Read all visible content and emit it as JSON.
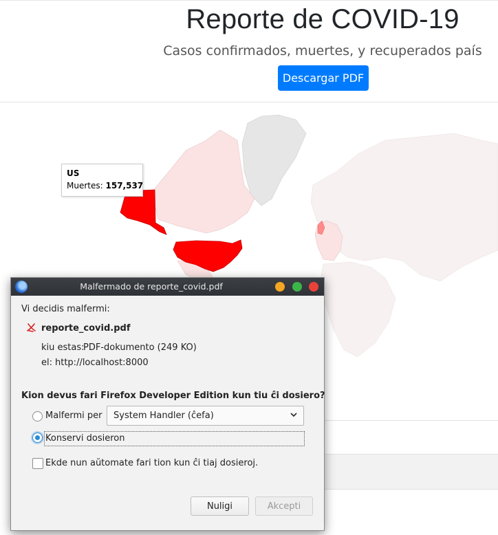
{
  "page": {
    "title": "Reporte de COVID-19",
    "subtitle": "Casos confirmados, muertes, y recuperados país",
    "download_button": "Descargar PDF"
  },
  "map": {
    "tooltip": {
      "country": "US",
      "label": "Muertes:",
      "value": "157,537"
    },
    "colors": {
      "highlight": "#ff0000",
      "light": "#fbe3e3",
      "none": "#e6e6e6",
      "faint": "#f7f1f1"
    }
  },
  "dialog": {
    "window_title": "Malfermado de reporte_covid.pdf",
    "intro": "Vi decidis malfermi:",
    "file_name": "reporte_covid.pdf",
    "type_label": "kiu estas:",
    "type_value": "PDF-dokumento (249 KO)",
    "from_label": "el:",
    "from_value": "http://localhost:8000",
    "question": "Kion devus fari Firefox Developer Edition kun tiu ĉi dosiero?",
    "open_with_label": "Malfermi per",
    "open_with_value": "System Handler (ĉefa)",
    "save_label": "Konservi dosieron",
    "auto_label": "Ekde nun aŭtomate fari tion kun ĉi tiaj dosieroj.",
    "cancel_button": "Nuligi",
    "ok_button": "Akcepti",
    "colors": {
      "titlebar": "#35383c",
      "minimize": "#f5a623",
      "maximize": "#3bb54a",
      "close": "#e8423b",
      "accent": "#2a8bd6"
    }
  }
}
